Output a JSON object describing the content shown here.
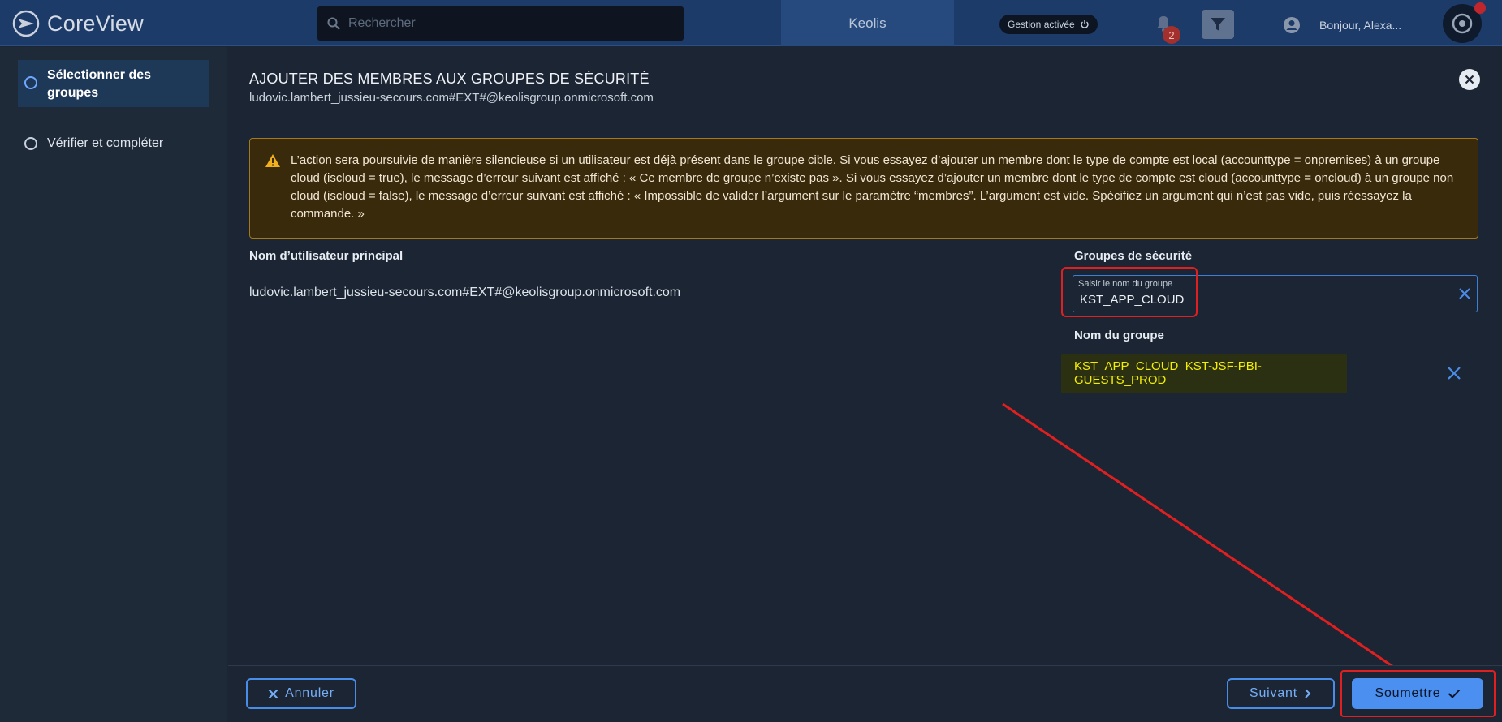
{
  "app": {
    "name": "CoreView"
  },
  "header": {
    "search_placeholder": "Rechercher",
    "tenant": "Keolis",
    "management_label": "Gestion activée",
    "notification_count": "2",
    "greeting": "Bonjour, Alexa..."
  },
  "sidebar": {
    "steps": [
      {
        "label": "Sélectionner des groupes",
        "active": true
      },
      {
        "label": "Vérifier et compléter",
        "active": false
      }
    ]
  },
  "dialog": {
    "title": "AJOUTER DES MEMBRES AUX GROUPES DE SÉCURITÉ",
    "subtitle": "ludovic.lambert_jussieu-secours.com#EXT#@keolisgroup.onmicrosoft.com",
    "warning": "L’action sera poursuivie de manière silencieuse si un utilisateur est déjà présent dans le groupe cible. Si vous essayez d’ajouter un membre dont le type de compte est local (accounttype = onpremises) à un groupe cloud (iscloud = true), le message d’erreur suivant est affiché : « Ce membre de groupe n’existe pas ». Si vous essayez d’ajouter un membre dont le type de compte est cloud (accounttype = oncloud) à un groupe non cloud (iscloud = false), le message d’erreur suivant est affiché : « Impossible de valider l’argument sur le paramètre “membres”. L’argument est vide. Spécifiez un argument qui n’est pas vide, puis réessayez la commande. »",
    "upn_label": "Nom d’utilisateur principal",
    "upn_value": "ludovic.lambert_jussieu-secours.com#EXT#@keolisgroup.onmicrosoft.com",
    "groups_label": "Groupes de sécurité",
    "group_field_label": "Saisir le nom du groupe",
    "group_field_value": "KST_APP_CLOUD",
    "group_name_header": "Nom du groupe",
    "selected_groups": [
      "KST_APP_CLOUD_KST-JSF-PBI-GUESTS_PROD"
    ]
  },
  "footer": {
    "cancel_label": "Annuler",
    "next_label": "Suivant",
    "submit_label": "Soumettre"
  },
  "colors": {
    "accent": "#4b8ff0",
    "warning_border": "#a6781c",
    "highlight": "#e02020",
    "selected_text": "#f5f000"
  }
}
